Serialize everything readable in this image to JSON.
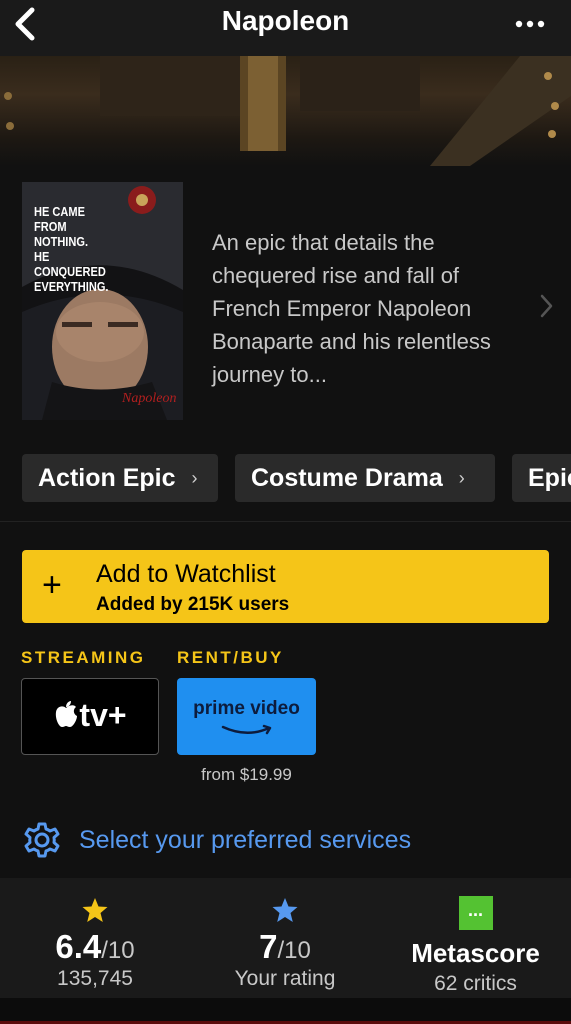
{
  "header": {
    "title": "Napoleon",
    "back_icon": "chevron-left-icon",
    "more_icon": "more-dots-icon"
  },
  "poster": {
    "tagline_lines": [
      "HE CAME FROM",
      "NOTHING.",
      "HE CONQUERED",
      "EVERYTHING."
    ]
  },
  "synopsis": {
    "text": "An epic that details the chequered rise and fall of French Emperor Napoleon Bonaparte and his relentless journey to..."
  },
  "genres": [
    "Action Epic",
    "Costume Drama",
    "Epic"
  ],
  "watchlist": {
    "title": "Add to Watchlist",
    "subtitle": "Added by 215K users",
    "color": "#f5c518"
  },
  "where_to_watch": {
    "streaming_label": "STREAMING",
    "rentbuy_label": "RENT/BUY",
    "streaming_service": "tv+",
    "rentbuy_service": "prime video",
    "rentbuy_price": "from $19.99"
  },
  "preferences": {
    "label": "Select your preferred services",
    "link_color": "#5799ef"
  },
  "ratings": {
    "imdb_score": "6.4",
    "imdb_scale": "/10",
    "imdb_count": "135,745",
    "user_score": "7",
    "user_scale": "/10",
    "user_label": "Your rating",
    "metascore_value": "...",
    "metascore_label": "Metascore",
    "metascore_critics": "62 critics",
    "star_color": "#f5c518",
    "user_star_color": "#5799ef",
    "metascore_color": "#54c232"
  }
}
